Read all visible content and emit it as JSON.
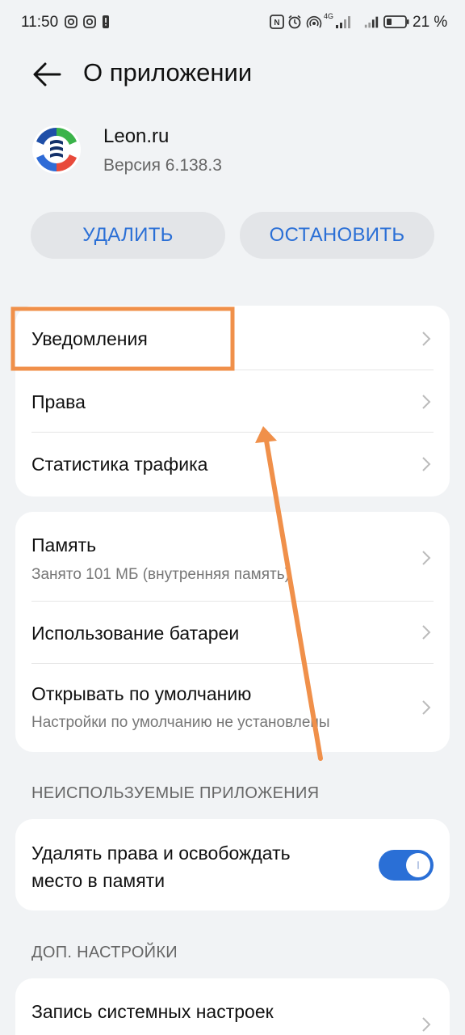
{
  "status_bar": {
    "time": "11:50",
    "network_label": "4G",
    "battery_percent": "21 %"
  },
  "header": {
    "title": "О приложении"
  },
  "app": {
    "name": "Leon.ru",
    "version": "Версия 6.138.3"
  },
  "actions": {
    "delete_label": "УДАЛИТЬ",
    "stop_label": "ОСТАНОВИТЬ"
  },
  "group1": {
    "items": [
      {
        "title": "Уведомления"
      },
      {
        "title": "Права"
      },
      {
        "title": "Статистика трафика"
      }
    ]
  },
  "group2": {
    "items": [
      {
        "title": "Память",
        "subtitle": "Занято 101 МБ (внутренняя память)"
      },
      {
        "title": "Использование батареи"
      },
      {
        "title": "Открывать по умолчанию",
        "subtitle": "Настройки по умолчанию не установлены"
      }
    ]
  },
  "unused_section": {
    "header": "НЕИСПОЛЬЗУЕМЫЕ ПРИЛОЖЕНИЯ",
    "line1": "Удалять права и освобождать",
    "line2": "место в памяти",
    "toggle_on": true
  },
  "extra_section": {
    "header": "ДОП. НАСТРОЙКИ",
    "item_title": "Запись системных настроек"
  },
  "colors": {
    "accent": "#2a6fd6",
    "annotation": "#f0904a",
    "background": "#f1f3f5"
  }
}
